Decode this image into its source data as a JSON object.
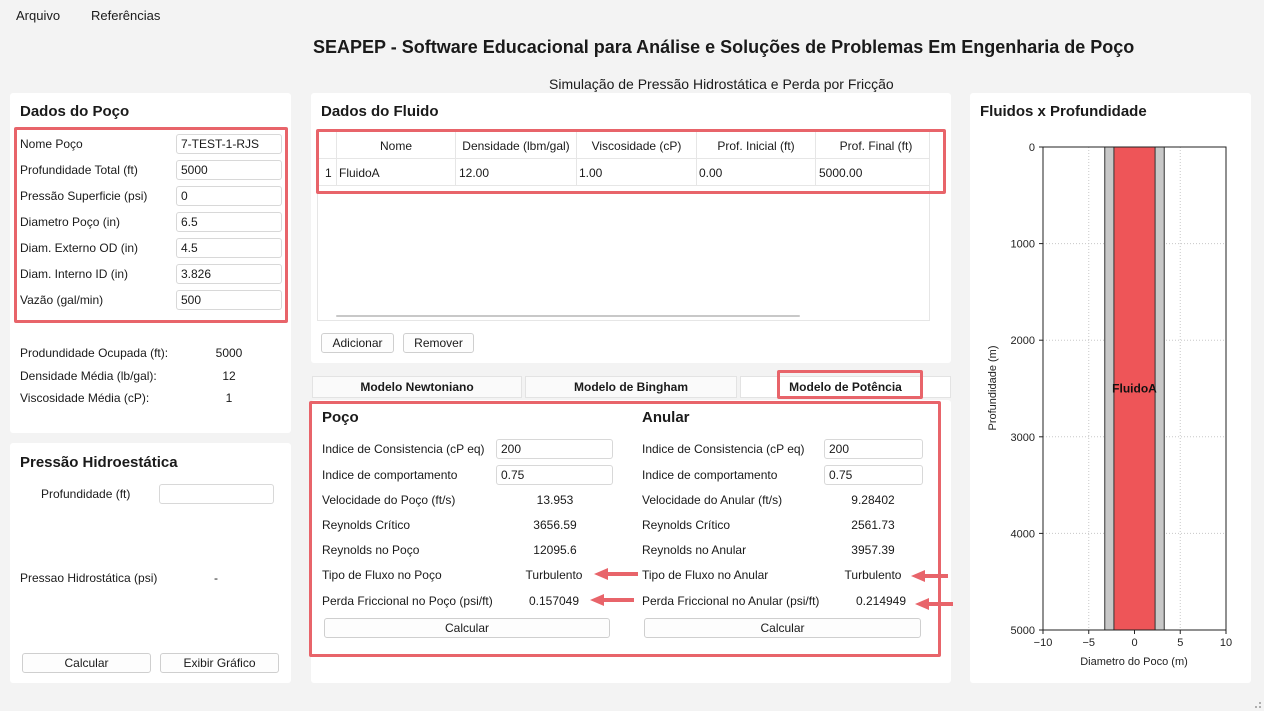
{
  "menu": {
    "file": "Arquivo",
    "refs": "Referências"
  },
  "header": {
    "title": "SEAPEP - Software Educacional para Análise e Soluções de Problemas Em Engenharia de Poço",
    "subtitle": "Simulação de Pressão Hidrostática e Perda por Fricção"
  },
  "well": {
    "title": "Dados do Poço",
    "fields": [
      {
        "label": "Nome Poço",
        "value": "7-TEST-1-RJS"
      },
      {
        "label": "Profundidade Total (ft)",
        "value": "5000"
      },
      {
        "label": "Pressão Superficie (psi)",
        "value": "0"
      },
      {
        "label": "Diametro Poço (in)",
        "value": "6.5"
      },
      {
        "label": "Diam. Externo OD (in)",
        "value": "4.5"
      },
      {
        "label": "Diam. Interno ID  (in)",
        "value": "3.826"
      },
      {
        "label": "Vazão (gal/min)",
        "value": "500"
      }
    ],
    "summary": [
      {
        "label": "Produndidade Ocupada (ft):",
        "value": "5000"
      },
      {
        "label": "Densidade Média (lb/gal):",
        "value": "12"
      },
      {
        "label": "Viscosidade Média (cP):",
        "value": "1"
      }
    ]
  },
  "hydro": {
    "title": "Pressão Hidroestática",
    "depth_label": "Profundidade (ft)",
    "depth_value": "",
    "pressure_label": "Pressao Hidrostática (psi)",
    "pressure_value": "-",
    "calc_btn": "Calcular",
    "chart_btn": "Exibir Gráfico"
  },
  "fluid": {
    "title": "Dados do Fluido",
    "columns": [
      "Nome",
      "Densidade (lbm/gal)",
      "Viscosidade (cP)",
      "Prof. Inicial (ft)",
      "Prof. Final (ft)"
    ],
    "rows": [
      {
        "index": "1",
        "cells": [
          "FluidoA",
          "12.00",
          "1.00",
          "0.00",
          "5000.00"
        ]
      }
    ],
    "add_btn": "Adicionar",
    "remove_btn": "Remover"
  },
  "tabs": [
    "Modelo Newtoniano",
    "Modelo de Bingham",
    "Modelo de Potência"
  ],
  "power": {
    "well": {
      "title": "Poço",
      "k_label": "Indice de Consistencia (cP eq)",
      "k_value": "200",
      "n_label": "Indice de comportamento",
      "n_value": "0.75",
      "rows": [
        {
          "label": "Velocidade do Poço (ft/s)",
          "value": "13.953"
        },
        {
          "label": "Reynolds Crítico",
          "value": "3656.59"
        },
        {
          "label": "Reynolds no Poço",
          "value": "12095.6"
        },
        {
          "label": "Tipo de Fluxo no Poço",
          "value": "Turbulento"
        },
        {
          "label": "Perda Friccional no Poço (psi/ft)",
          "value": "0.157049"
        }
      ],
      "calc_btn": "Calcular"
    },
    "annulus": {
      "title": "Anular",
      "k_label": "Indice de Consistencia (cP eq)",
      "k_value": "200",
      "n_label": "Indice de comportamento",
      "n_value": "0.75",
      "rows": [
        {
          "label": "Velocidade do Anular (ft/s)",
          "value": "9.28402"
        },
        {
          "label": "Reynolds Crítico",
          "value": "2561.73"
        },
        {
          "label": "Reynolds no Anular",
          "value": "3957.39"
        },
        {
          "label": "Tipo de Fluxo no Anular",
          "value": "Turbulento"
        },
        {
          "label": "Perda Friccional no Anular (psi/ft)",
          "value": "0.214949"
        }
      ],
      "calc_btn": "Calcular"
    }
  },
  "colors": {
    "highlight": "#e8646a",
    "fluid": "#ee5558",
    "pipe": "#c8c8c8"
  },
  "chart_data": {
    "type": "area",
    "title": "Fluidos x Profundidade",
    "xlabel": "Diametro do Poco (m)",
    "ylabel": "Profundidade (m)",
    "xlim": [
      -10,
      10
    ],
    "ylim": [
      5000,
      0
    ],
    "xticks": [
      "−10",
      "−5",
      "0",
      "5",
      "10"
    ],
    "yticks": [
      "0",
      "1000",
      "2000",
      "3000",
      "4000",
      "5000"
    ],
    "grid": true,
    "wellbore": {
      "x": [
        -3.25,
        3.25
      ],
      "depth": [
        0,
        5000
      ]
    },
    "series": [
      {
        "name": "FluidoA",
        "x": [
          -2.25,
          2.25
        ],
        "depth": [
          0,
          5000
        ]
      }
    ]
  }
}
